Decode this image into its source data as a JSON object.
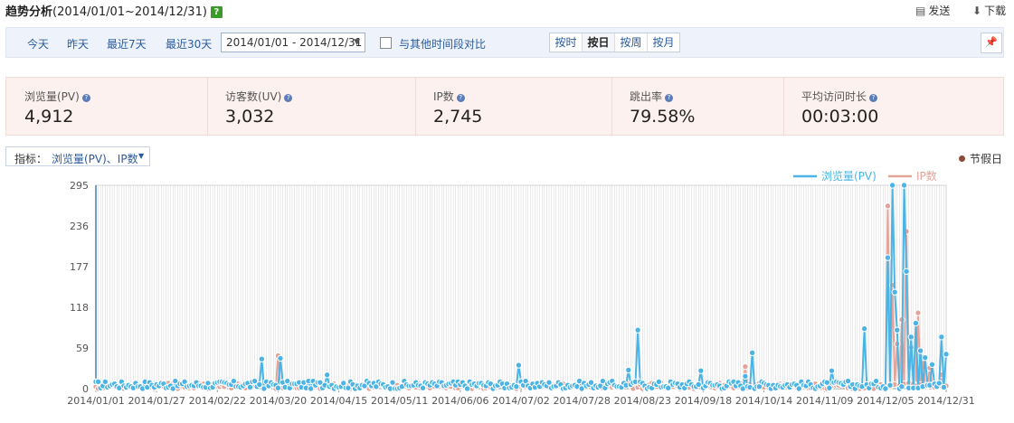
{
  "page": {
    "title_bold": "趋势分析",
    "title_range": "(2014/01/01~2014/12/31)",
    "help_icon": "question-icon",
    "send_label": "发送",
    "download_label": "下载"
  },
  "toolbar": {
    "quick_ranges": [
      "今天",
      "昨天",
      "最近7天",
      "最近30天"
    ],
    "date_range": "2014/01/01 - 2014/12/31",
    "compare_label": "与其他时间段对比",
    "granularity": [
      "按时",
      "按日",
      "按周",
      "按月"
    ],
    "granularity_selected": "按日"
  },
  "stats": [
    {
      "label": "浏览量(PV)",
      "value": "4,912"
    },
    {
      "label": "访客数(UV)",
      "value": "3,032"
    },
    {
      "label": "IP数",
      "value": "2,745"
    },
    {
      "label": "跳出率",
      "value": "79.58%"
    },
    {
      "label": "平均访问时长",
      "value": "00:03:00"
    }
  ],
  "metric": {
    "label": "指标：",
    "value": "浏览量(PV)、IP数"
  },
  "holiday_label": "节假日",
  "colors": {
    "pv": "#4cb4e4",
    "ip": "#e3a49a",
    "holiday": "#8c4c3c",
    "accent": "#2a5b9c"
  },
  "chart_data": {
    "type": "line",
    "y_ticks": [
      0,
      59,
      118,
      177,
      236,
      295
    ],
    "ylim": [
      0,
      295
    ],
    "x_tick_labels": [
      "2014/01/01",
      "2014/01/27",
      "2014/02/22",
      "2014/03/20",
      "2014/04/15",
      "2014/05/11",
      "2014/06/06",
      "2014/07/02",
      "2014/07/28",
      "2014/08/23",
      "2014/09/18",
      "2014/10/14",
      "2014/11/09",
      "2014/12/05",
      "2014/12/31"
    ],
    "x_start": "2014/01/01",
    "x_end": "2014/12/31",
    "legend": "top-right",
    "grid": true,
    "series": [
      {
        "name": "浏览量(PV)",
        "peaks": [
          [
            "2014/03/13",
            43
          ],
          [
            "2014/03/21",
            44
          ],
          [
            "2014/04/10",
            20
          ],
          [
            "2014/07/01",
            34
          ],
          [
            "2014/08/17",
            27
          ],
          [
            "2014/08/21",
            85
          ],
          [
            "2014/09/17",
            26
          ],
          [
            "2014/10/06",
            18
          ],
          [
            "2014/10/09",
            52
          ],
          [
            "2014/11/12",
            26
          ],
          [
            "2014/11/26",
            87
          ],
          [
            "2014/12/06",
            190
          ],
          [
            "2014/12/08",
            300
          ],
          [
            "2014/12/09",
            140
          ],
          [
            "2014/12/10",
            85
          ],
          [
            "2014/12/13",
            295
          ],
          [
            "2014/12/14",
            170
          ],
          [
            "2014/12/16",
            75
          ],
          [
            "2014/12/18",
            95
          ],
          [
            "2014/12/20",
            55
          ],
          [
            "2014/12/22",
            45
          ],
          [
            "2014/12/25",
            35
          ],
          [
            "2014/12/29",
            75
          ],
          [
            "2014/12/31",
            50
          ]
        ]
      },
      {
        "name": "IP数",
        "peaks": [
          [
            "2014/03/20",
            48
          ],
          [
            "2014/06/10",
            10
          ],
          [
            "2014/10/06",
            32
          ],
          [
            "2014/12/06",
            265
          ],
          [
            "2014/12/08",
            150
          ],
          [
            "2014/12/10",
            65
          ],
          [
            "2014/12/12",
            100
          ],
          [
            "2014/12/14",
            228
          ],
          [
            "2014/12/16",
            60
          ],
          [
            "2014/12/19",
            110
          ],
          [
            "2014/12/21",
            45
          ],
          [
            "2014/12/24",
            30
          ],
          [
            "2014/12/29",
            20
          ]
        ]
      }
    ]
  }
}
